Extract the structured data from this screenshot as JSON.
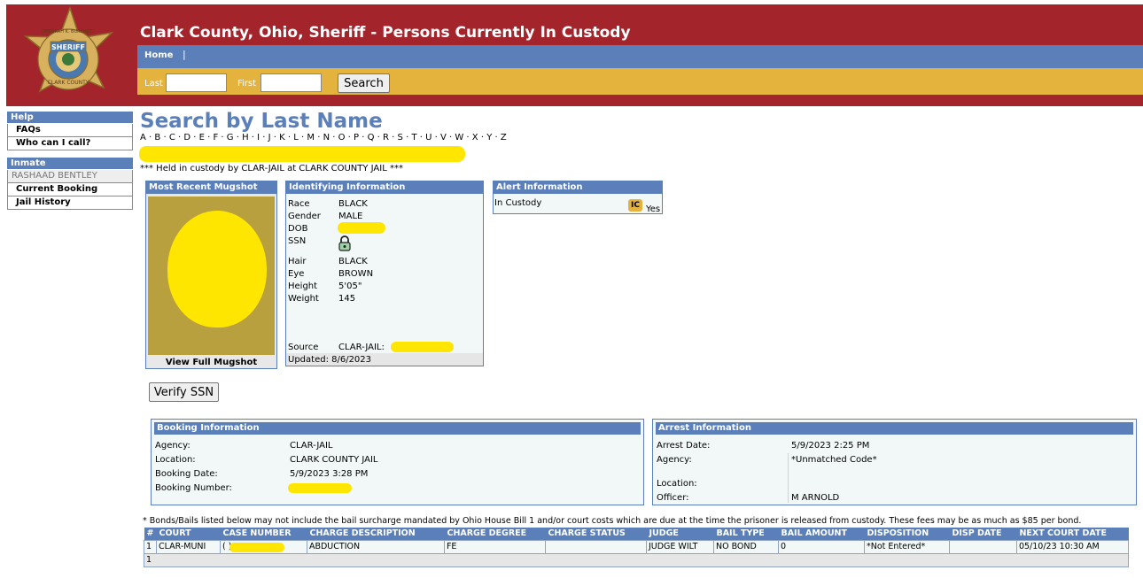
{
  "header": {
    "title": "Clark County, Ohio, Sheriff - Persons Currently In Custody",
    "badge": {
      "top_text": "DEBORAH K. BURCHETT",
      "middle_text": "SHERIFF",
      "bottom_text": "CLARK COUNTY"
    },
    "nav": {
      "home": "Home",
      "separator": "|"
    },
    "search": {
      "last_label": "Last",
      "first_label": "First",
      "last_value": "",
      "first_value": "",
      "button": "Search"
    },
    "colors": {
      "brand_red": "#a3252b",
      "nav_blue": "#5b7fb9",
      "search_gold": "#e3b33e"
    }
  },
  "sidebar": {
    "help_heading": "Help",
    "help_items": [
      "FAQs",
      "Who can I call?"
    ],
    "inmate_heading": "Inmate",
    "inmate_name": "RASHAAD BENTLEY",
    "inmate_items": [
      "Current Booking",
      "Jail History"
    ]
  },
  "main": {
    "title": "Search by Last Name",
    "letters": [
      "A",
      "B",
      "C",
      "D",
      "E",
      "F",
      "G",
      "H",
      "I",
      "J",
      "K",
      "L",
      "M",
      "N",
      "O",
      "P",
      "Q",
      "R",
      "S",
      "T",
      "U",
      "V",
      "W",
      "X",
      "Y",
      "Z"
    ],
    "letter_separator": " · ",
    "custody_line": "*** Held in custody by CLAR-JAIL at CLARK COUNTY JAIL ***"
  },
  "mugshot": {
    "heading": "Most Recent Mugshot",
    "link": "View Full Mugshot"
  },
  "identifying": {
    "heading": "Identifying Information",
    "fields": [
      {
        "label": "Race",
        "value": "BLACK"
      },
      {
        "label": "Gender",
        "value": "MALE"
      },
      {
        "label": "DOB",
        "value": ""
      },
      {
        "label": "SSN",
        "value": ""
      },
      {
        "label": "Hair",
        "value": "BLACK"
      },
      {
        "label": "Eye",
        "value": "BROWN"
      },
      {
        "label": "Height",
        "value": "5'05\""
      },
      {
        "label": "Weight",
        "value": "145"
      }
    ],
    "ssn_icon": "lock-icon",
    "source_label": "Source",
    "source_value": "CLAR-JAIL:",
    "updated": "Updated: 8/6/2023"
  },
  "alert": {
    "heading": "Alert Information",
    "label": "In Custody",
    "badge": "IC",
    "value": "Yes"
  },
  "verify_button": "Verify SSN",
  "booking": {
    "heading": "Booking Information",
    "fields": [
      {
        "label": "Agency:",
        "value": "CLAR-JAIL"
      },
      {
        "label": "Location:",
        "value": "CLARK COUNTY JAIL"
      },
      {
        "label": "Booking Date:",
        "value": "5/9/2023 3:28 PM"
      },
      {
        "label": "Booking Number:",
        "value": ""
      }
    ]
  },
  "arrest": {
    "heading": "Arrest Information",
    "fields": [
      {
        "label": "Arrest Date:",
        "value": "5/9/2023 2:25 PM"
      },
      {
        "label": "Agency:",
        "value": "*Unmatched Code*"
      },
      {
        "label": "Location:",
        "value": ""
      },
      {
        "label": "Officer:",
        "value": "M ARNOLD"
      }
    ]
  },
  "bond_note": "* Bonds/Bails listed below may not include the bail surcharge mandated by Ohio House Bill 1 and/or court costs which are due at the time the prisoner is released from custody. These fees may be as much as $85 per bond.",
  "charges": {
    "columns": [
      "#",
      "COURT",
      "CASE NUMBER",
      "CHARGE DESCRIPTION",
      "CHARGE DEGREE",
      "CHARGE STATUS",
      "JUDGE",
      "BAIL TYPE",
      "BAIL AMOUNT",
      "DISPOSITION",
      "DISP DATE",
      "NEXT COURT DATE"
    ],
    "rows": [
      [
        "1",
        "CLAR-MUNI",
        "(                    )",
        "ABDUCTION",
        "FE",
        "",
        "JUDGE WILT",
        "NO BOND",
        "0",
        "*Not Entered*",
        "",
        "05/10/23 10:30 AM"
      ]
    ],
    "footer_count": "1"
  }
}
